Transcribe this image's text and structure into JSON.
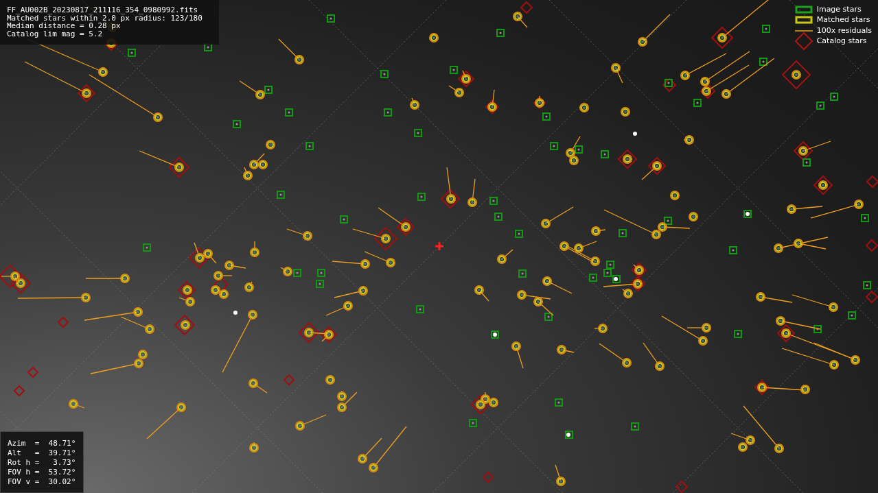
{
  "file_info": {
    "lines": [
      "FF_AU002B_20230817_211116_354_0980992.fits",
      "Matched stars within 2.0 px radius: 123/180",
      "Median distance = 0.28 px",
      "Catalog lim mag = 5.2"
    ]
  },
  "legend": [
    {
      "kind": "image",
      "label": "Image stars"
    },
    {
      "kind": "matched",
      "label": "Matched stars"
    },
    {
      "kind": "residual",
      "label": "100x residuals"
    },
    {
      "kind": "catalog",
      "label": "Catalog stars"
    }
  ],
  "pointing": {
    "lines": [
      "Azim  =  48.71°",
      "Alt   =  39.71°",
      "Rot h =   3.73°",
      "FOV h =  53.72°",
      "FOV v =  30.02°"
    ]
  }
}
